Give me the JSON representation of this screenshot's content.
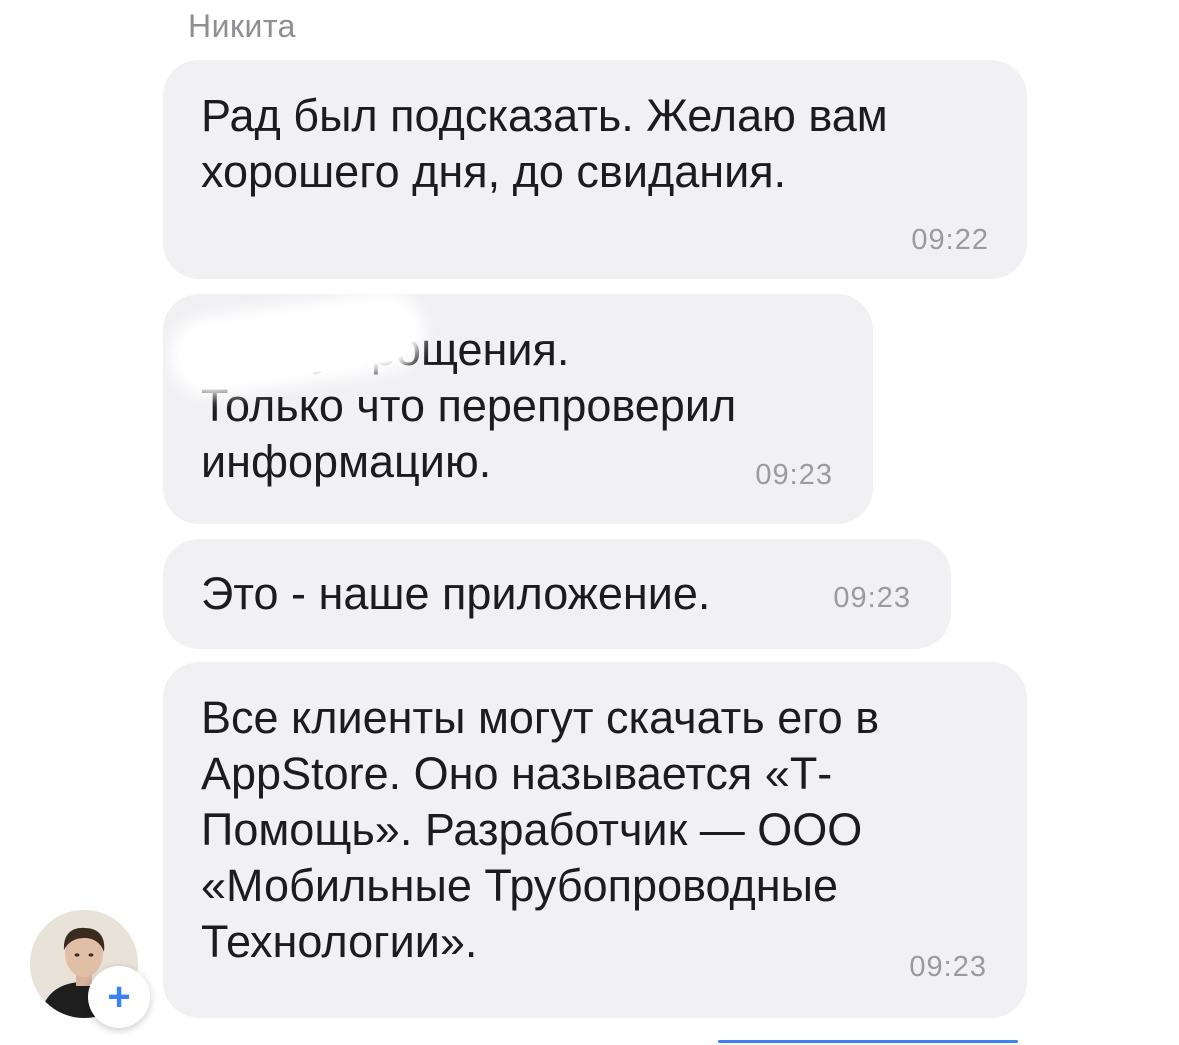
{
  "chat": {
    "sender_name": "Никита",
    "messages": [
      {
        "text": "Рад был подсказать. Желаю вам\nхорошего дня, до свидания.",
        "time": "09:22"
      },
      {
        "text": "         прошу прощения.\nТолько что перепроверил\nинформацию.",
        "time": "09:23"
      },
      {
        "text": "Это - наше приложение.",
        "time": "09:23"
      },
      {
        "text": "Все клиенты могут скачать его в\nAppStore. Оно называется «Т-\nПомощь». Разработчик — ООО\n«Мобильные Трубопроводные\nТехнологии».",
        "time": "09:23"
      }
    ],
    "add_button_label": "+"
  },
  "colors": {
    "bubble": "#f1f1f4",
    "accent": "#3b82f6",
    "time": "#9a9aa0",
    "sender": "#8e8e93"
  },
  "icons": {
    "avatar": "contact-avatar",
    "add": "plus-icon"
  }
}
